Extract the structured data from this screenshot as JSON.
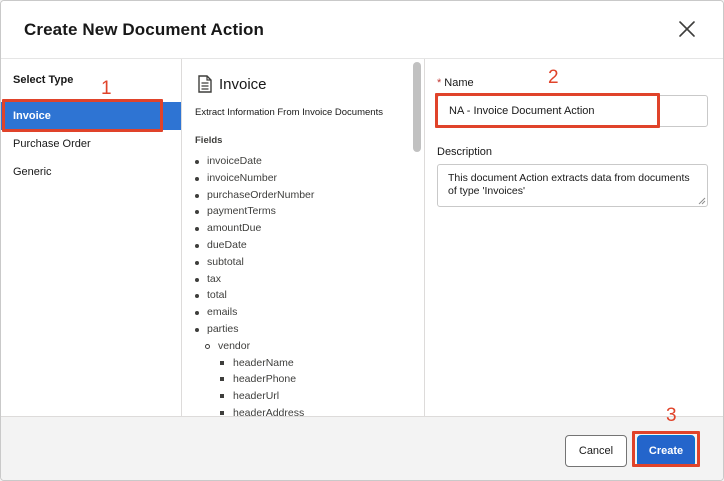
{
  "modal": {
    "title": "Create New Document Action",
    "close_icon": "close-icon"
  },
  "select_type": {
    "label": "Select Type",
    "items": [
      {
        "label": "Invoice",
        "selected": true
      },
      {
        "label": "Purchase Order",
        "selected": false
      },
      {
        "label": "Generic",
        "selected": false
      }
    ]
  },
  "detail": {
    "icon": "document-icon",
    "title": "Invoice",
    "description": "Extract Information From Invoice Documents",
    "fields_label": "Fields",
    "fields": [
      {
        "label": "invoiceDate",
        "level": 1
      },
      {
        "label": "invoiceNumber",
        "level": 1
      },
      {
        "label": "purchaseOrderNumber",
        "level": 1
      },
      {
        "label": "paymentTerms",
        "level": 1
      },
      {
        "label": "amountDue",
        "level": 1
      },
      {
        "label": "dueDate",
        "level": 1
      },
      {
        "label": "subtotal",
        "level": 1
      },
      {
        "label": "tax",
        "level": 1
      },
      {
        "label": "total",
        "level": 1
      },
      {
        "label": "emails",
        "level": 1
      },
      {
        "label": "parties",
        "level": 1
      },
      {
        "label": "vendor",
        "level": 2
      },
      {
        "label": "headerName",
        "level": 3
      },
      {
        "label": "headerPhone",
        "level": 3
      },
      {
        "label": "headerUrl",
        "level": 3
      },
      {
        "label": "headerAddress",
        "level": 3
      }
    ]
  },
  "form": {
    "name_required_mark": "*",
    "name_label": "Name",
    "name_value": "NA - Invoice Document Action",
    "description_label": "Description",
    "description_value": "This document Action extracts data from documents of type 'Invoices'"
  },
  "footer": {
    "cancel_label": "Cancel",
    "create_label": "Create"
  },
  "annotations": {
    "step1": "1",
    "step2": "2",
    "step3": "3",
    "color": "#e0432a"
  },
  "colors": {
    "selected_bg": "#2e74d3",
    "primary_button": "#2465cb",
    "required": "#c23934"
  }
}
